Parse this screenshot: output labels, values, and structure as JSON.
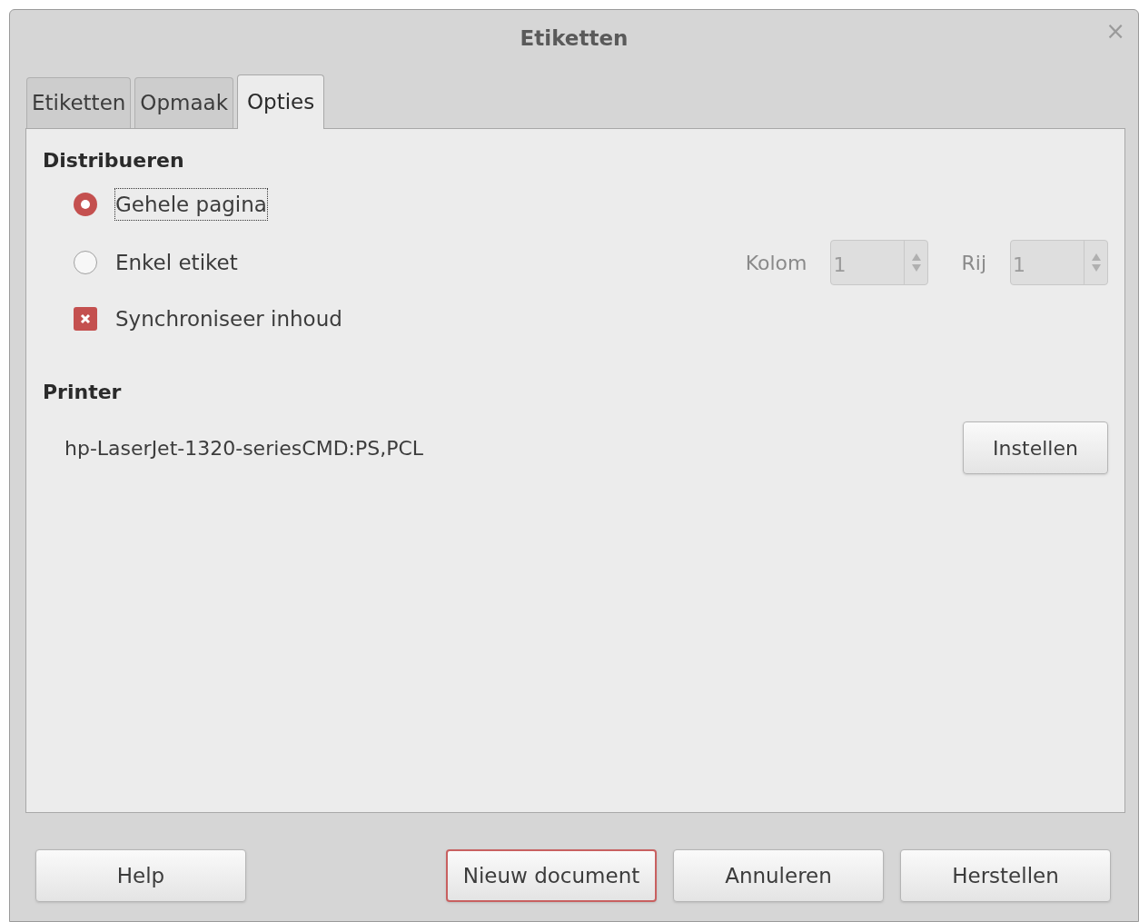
{
  "window": {
    "title": "Etiketten",
    "close": "×"
  },
  "tabs": [
    {
      "label": "Etiketten",
      "selected": false
    },
    {
      "label": "Opmaak",
      "selected": false
    },
    {
      "label": "Opties",
      "selected": true
    }
  ],
  "distribute": {
    "heading": "Distribueren",
    "options": [
      {
        "label": "Gehele pagina",
        "selected": true,
        "focused": true
      },
      {
        "label": "Enkel etiket",
        "selected": false,
        "focused": false
      }
    ],
    "spinners": [
      {
        "label": "Kolom",
        "value": "1",
        "disabled": true
      },
      {
        "label": "Rij",
        "value": "1",
        "disabled": true
      }
    ],
    "sync": {
      "label": "Synchroniseer inhoud",
      "checked": true
    }
  },
  "printer": {
    "heading": "Printer",
    "name": "hp-LaserJet-1320-seriesCMD:PS,PCL",
    "button": "Instellen"
  },
  "buttons": [
    {
      "label": "Help",
      "default": false
    },
    {
      "label": "Nieuw document",
      "default": true
    },
    {
      "label": "Annuleren",
      "default": false
    },
    {
      "label": "Herstellen",
      "default": false
    }
  ]
}
